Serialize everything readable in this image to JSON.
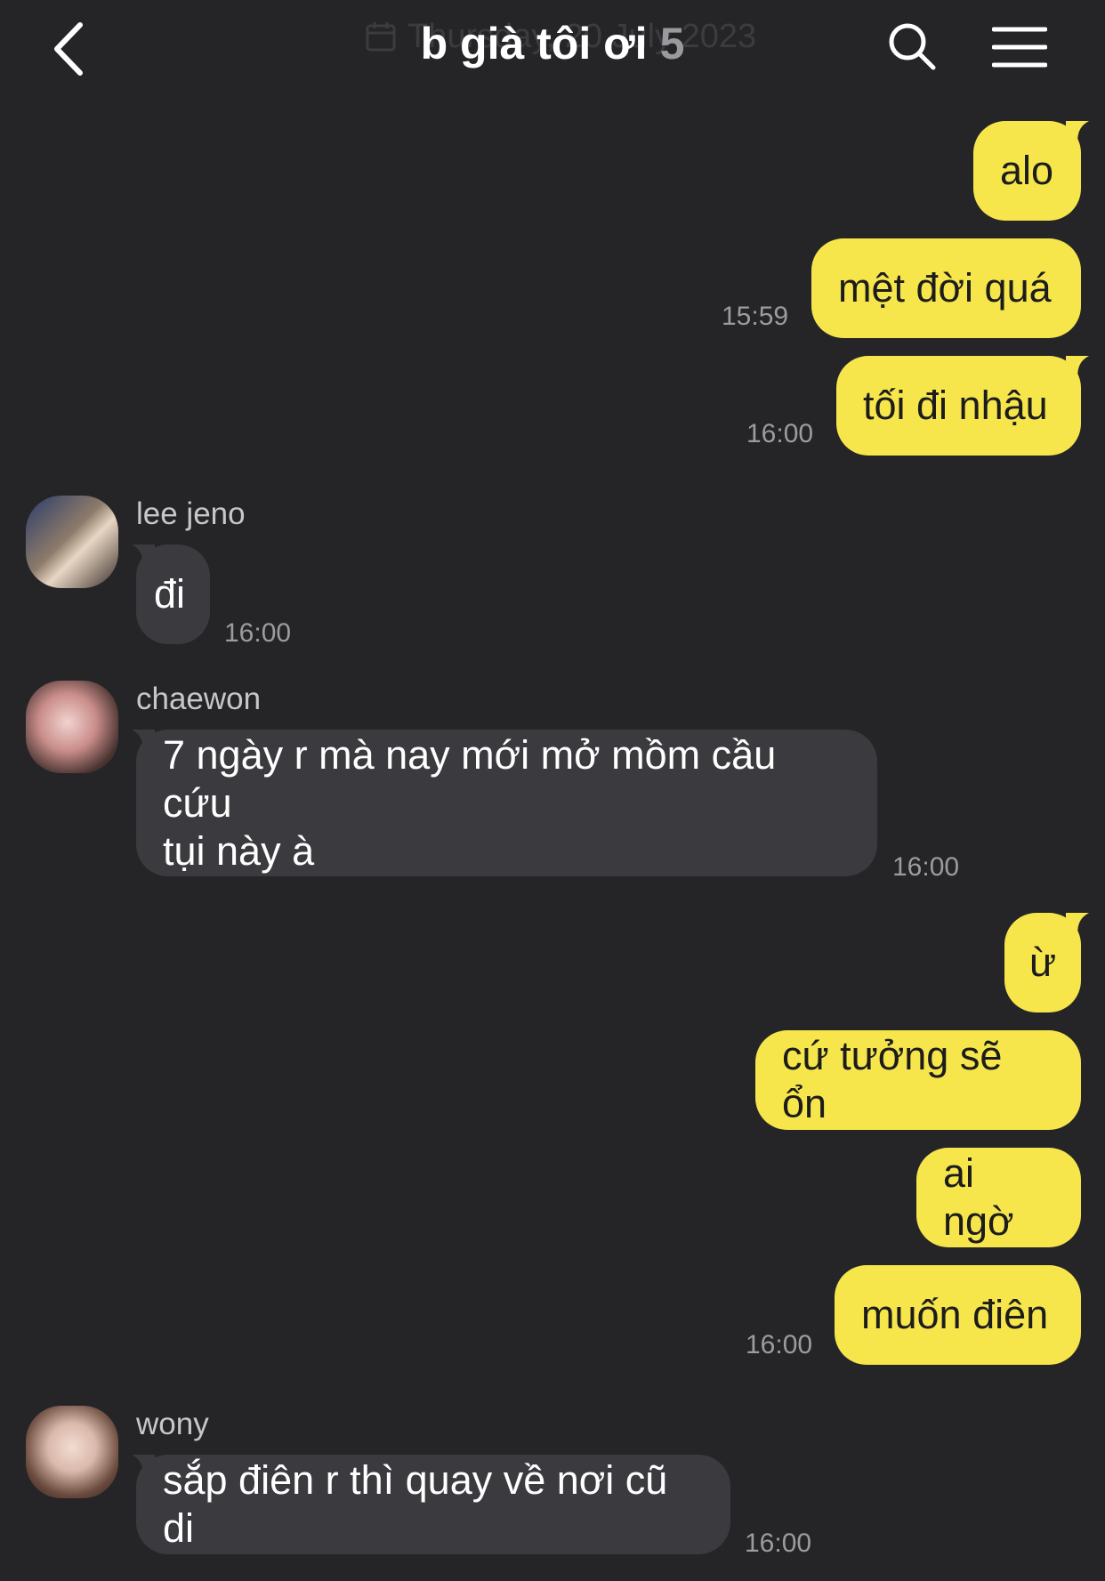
{
  "header": {
    "date_text": "Thursday, 20 July 2023",
    "title": "b già tôi ơi",
    "member_count": "5"
  },
  "messages": [
    {
      "text": "alo"
    },
    {
      "text": "mệt đời quá",
      "time": "15:59"
    },
    {
      "text": "tối đi nhậu",
      "time": "16:00"
    },
    {
      "sender": "lee jeno",
      "text": "đi",
      "time": "16:00"
    },
    {
      "sender": "chaewon",
      "line1": "7 ngày r mà nay mới mở mồm cầu cứu",
      "line2": "tụi này à",
      "time": "16:00"
    },
    {
      "text": "ừ"
    },
    {
      "text": "cứ tưởng sẽ ổn"
    },
    {
      "text": "ai ngờ"
    },
    {
      "text": "muốn điên",
      "time": "16:00"
    },
    {
      "sender": "wony",
      "text": "sắp điên r thì quay về nơi cũ di",
      "time": "16:00"
    }
  ],
  "colors": {
    "background": "#252528",
    "outgoing_bubble": "#f6e64c",
    "incoming_bubble": "#3b3b3f"
  },
  "icons": [
    "chevron-left-icon",
    "calendar-icon",
    "search-icon",
    "menu-icon"
  ]
}
